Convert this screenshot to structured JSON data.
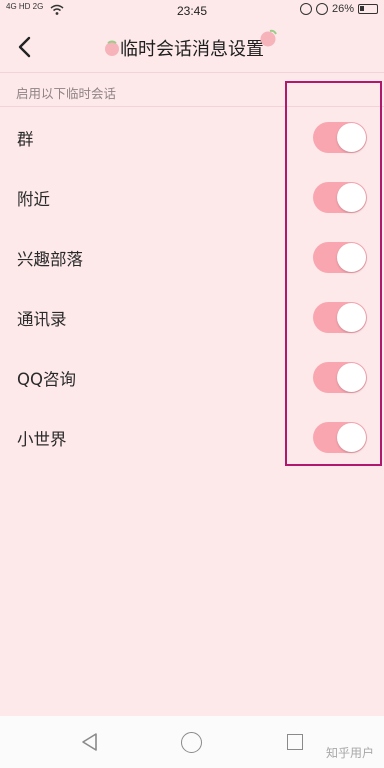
{
  "status_bar": {
    "signal_text": "4G HD 2G",
    "time": "23:45",
    "battery": "26%"
  },
  "header": {
    "title": "临时会话消息设置"
  },
  "section": {
    "header": "启用以下临时会话"
  },
  "items": [
    {
      "label": "群",
      "enabled": true
    },
    {
      "label": "附近",
      "enabled": true
    },
    {
      "label": "兴趣部落",
      "enabled": true
    },
    {
      "label": "通讯录",
      "enabled": true
    },
    {
      "label": "QQ咨询",
      "enabled": true
    },
    {
      "label": "小世界",
      "enabled": true
    }
  ],
  "watermark": "知乎用户",
  "colors": {
    "background": "#fde9ea",
    "toggle_on": "#f9a6b0",
    "highlight_border": "#b0176e"
  }
}
